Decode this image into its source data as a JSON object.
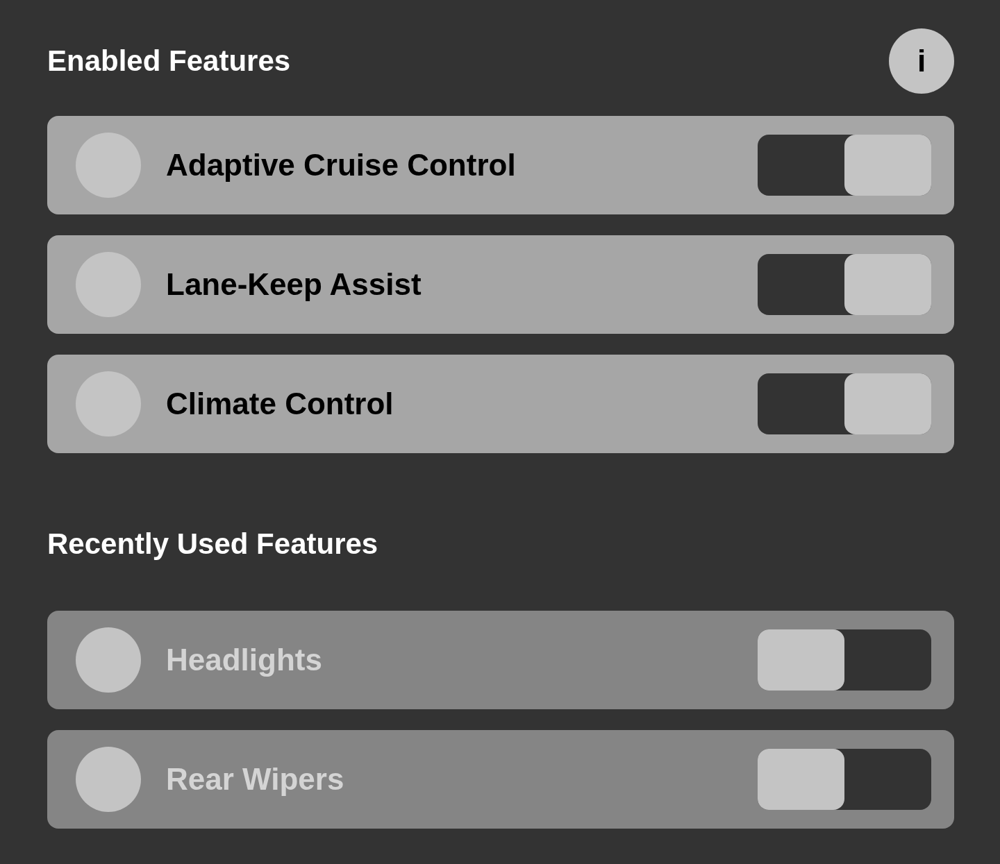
{
  "sections": [
    {
      "title": "Enabled Features",
      "info_button": "i",
      "features": [
        {
          "label": "Adaptive Cruise Control",
          "on": true
        },
        {
          "label": "Lane-Keep Assist",
          "on": true
        },
        {
          "label": "Climate Control",
          "on": true
        }
      ]
    },
    {
      "title": "Recently Used Features",
      "features": [
        {
          "label": "Headlights",
          "on": false
        },
        {
          "label": "Rear Wipers",
          "on": false
        }
      ]
    }
  ]
}
